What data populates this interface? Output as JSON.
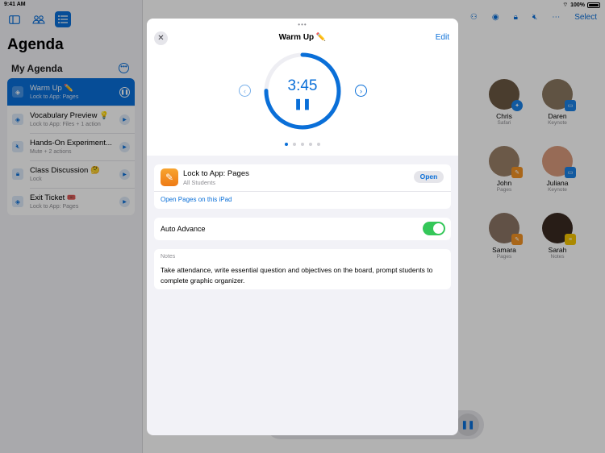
{
  "status_bar": {
    "time": "9:41 AM",
    "battery": "100%"
  },
  "sidebar": {
    "title": "Agenda",
    "section": "My Agenda",
    "items": [
      {
        "title": "Warm Up ✏️",
        "subtitle": "Lock to App: Pages",
        "icon": "layers-icon",
        "active": true
      },
      {
        "title": "Vocabulary Preview 💡",
        "subtitle": "Lock to App: Files + 1 action",
        "icon": "layers-icon"
      },
      {
        "title": "Hands-On Experiment...",
        "subtitle": "Mute + 2 actions",
        "icon": "mute-icon"
      },
      {
        "title": "Class Discussion 🤔",
        "subtitle": "Lock",
        "icon": "lock-icon"
      },
      {
        "title": "Exit Ticket 🎟️",
        "subtitle": "Lock to App: Pages",
        "icon": "layers-icon"
      }
    ]
  },
  "toolbar": {
    "select_label": "Select"
  },
  "students": [
    {
      "name": "Chris",
      "app": "Safari"
    },
    {
      "name": "Daren",
      "app": "Keynote"
    },
    {
      "name": "John",
      "app": "Pages"
    },
    {
      "name": "Juliana",
      "app": "Keynote"
    },
    {
      "name": "Samara",
      "app": "Pages"
    },
    {
      "name": "Sarah",
      "app": "Notes"
    }
  ],
  "modal": {
    "title": "Warm Up ✏️",
    "edit_label": "Edit",
    "timer": "3:45",
    "timer_progress": 0.75,
    "page_count": 5,
    "current_page": 1,
    "app_lock": {
      "title": "Lock to App: Pages",
      "subtitle": "All Students",
      "open_label": "Open",
      "link": "Open Pages on this iPad"
    },
    "auto_advance": {
      "label": "Auto Advance",
      "enabled": true
    },
    "notes": {
      "label": "Notes",
      "text": "Take attendance, write essential question and objectives on the board, prompt students to complete graphic organizer."
    }
  },
  "colors": {
    "accent": "#0a6fd8",
    "toggle_on": "#34c759",
    "pages_orange": "#f39325",
    "keynote_blue": "#1a82e6"
  }
}
